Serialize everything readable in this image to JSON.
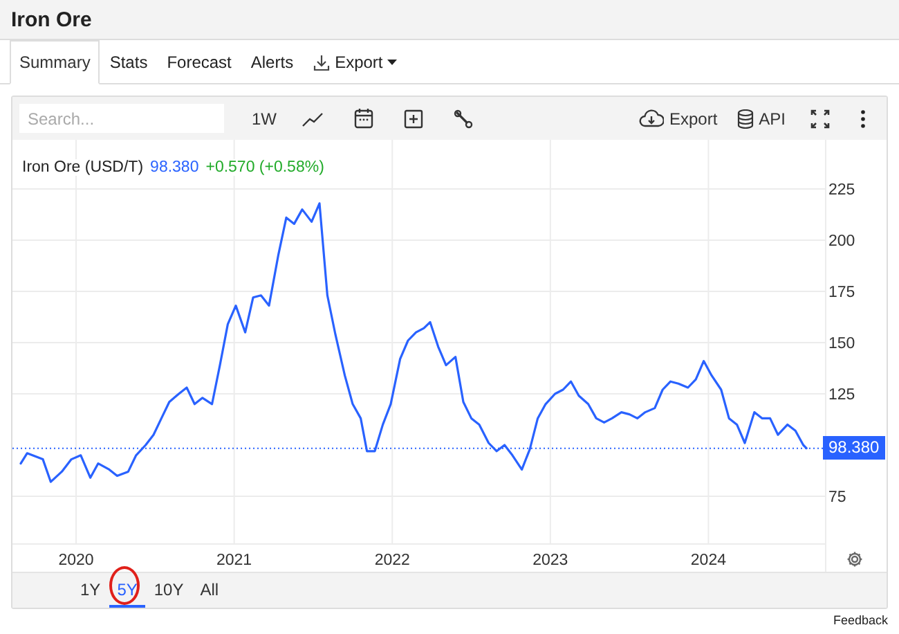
{
  "page": {
    "title": "Iron Ore",
    "feedback": "Feedback"
  },
  "tabs": [
    {
      "label": "Summary",
      "selected": true,
      "kind": "plain"
    },
    {
      "label": "Stats",
      "selected": false,
      "kind": "plain"
    },
    {
      "label": "Forecast",
      "selected": false,
      "kind": "plain"
    },
    {
      "label": "Alerts",
      "selected": false,
      "kind": "plain"
    },
    {
      "label": "Export",
      "selected": false,
      "kind": "download-menu"
    }
  ],
  "toolbar": {
    "search": {
      "placeholder": "Search..."
    },
    "interval": "1W",
    "export": "Export",
    "api": "API"
  },
  "legend": {
    "price": "98.380",
    "change": "+0.570 (+0.58%)"
  },
  "price_tag": "98.380",
  "chart_data": {
    "type": "line",
    "grid": true,
    "ref_lines": [
      {
        "axis": "y",
        "value": 98.4,
        "color": "#2962ff"
      }
    ],
    "xlim": [
      2019.615,
      2024.733
    ],
    "ylim": [
      53,
      249
    ],
    "xticks": [
      {
        "value": 2020,
        "label": "2020"
      },
      {
        "value": 2021,
        "label": "2021"
      },
      {
        "value": 2022,
        "label": "2022"
      },
      {
        "value": 2023,
        "label": "2023"
      },
      {
        "value": 2024,
        "label": "2024"
      }
    ],
    "yticks": [
      75,
      125,
      150,
      175,
      200,
      225
    ],
    "x": [
      2019.65,
      2019.69,
      2019.79,
      2019.84,
      2019.91,
      2019.97,
      2020.03,
      2020.09,
      2020.14,
      2020.21,
      2020.26,
      2020.33,
      2020.38,
      2020.44,
      2020.49,
      2020.54,
      2020.59,
      2020.65,
      2020.7,
      2020.75,
      2020.8,
      2020.86,
      2020.91,
      2020.96,
      2021.01,
      2021.07,
      2021.12,
      2021.17,
      2021.22,
      2021.28,
      2021.33,
      2021.38,
      2021.43,
      2021.49,
      2021.54,
      2021.59,
      2021.64,
      2021.7,
      2021.75,
      2021.8,
      2021.84,
      2021.89,
      2021.94,
      2021.99,
      2022.05,
      2022.1,
      2022.15,
      2022.2,
      2022.24,
      2022.29,
      2022.34,
      2022.4,
      2022.45,
      2022.5,
      2022.55,
      2022.61,
      2022.66,
      2022.71,
      2022.76,
      2022.82,
      2022.87,
      2022.92,
      2022.97,
      2023.03,
      2023.08,
      2023.13,
      2023.18,
      2023.24,
      2023.29,
      2023.34,
      2023.39,
      2023.45,
      2023.5,
      2023.55,
      2023.6,
      2023.66,
      2023.71,
      2023.76,
      2023.81,
      2023.87,
      2023.92,
      2023.97,
      2024.02,
      2024.08,
      2024.13,
      2024.18,
      2024.23,
      2024.29,
      2024.34,
      2024.39,
      2024.44,
      2024.5,
      2024.55,
      2024.6,
      2024.62
    ],
    "series": [
      {
        "name": "Iron Ore (USD/T)",
        "color": "#2962ff",
        "values": [
          91,
          96,
          93,
          82,
          87,
          93,
          95,
          84,
          91,
          88,
          85,
          87,
          95,
          100,
          105,
          113,
          121,
          125,
          128,
          120,
          123,
          120,
          139,
          159,
          168,
          155,
          172,
          173,
          168,
          193,
          211,
          208,
          215,
          209,
          218,
          173,
          154,
          134,
          120,
          113,
          97,
          97,
          110,
          120,
          142,
          151,
          155,
          157,
          160,
          148,
          139,
          143,
          121,
          113,
          110,
          101,
          97,
          100,
          95,
          88,
          98,
          113,
          120,
          125,
          127,
          131,
          124,
          120,
          113,
          111,
          113,
          116,
          115,
          113,
          116,
          118,
          127,
          131,
          130,
          128,
          132,
          141,
          134,
          127,
          113,
          110,
          101,
          116,
          113,
          113,
          105,
          110,
          107,
          100,
          98.4
        ]
      }
    ]
  },
  "ranges": [
    {
      "label": "1Y",
      "selected": false,
      "circled": false
    },
    {
      "label": "5Y",
      "selected": true,
      "circled": true
    },
    {
      "label": "10Y",
      "selected": false,
      "circled": false
    },
    {
      "label": "All",
      "selected": false,
      "circled": false
    }
  ]
}
